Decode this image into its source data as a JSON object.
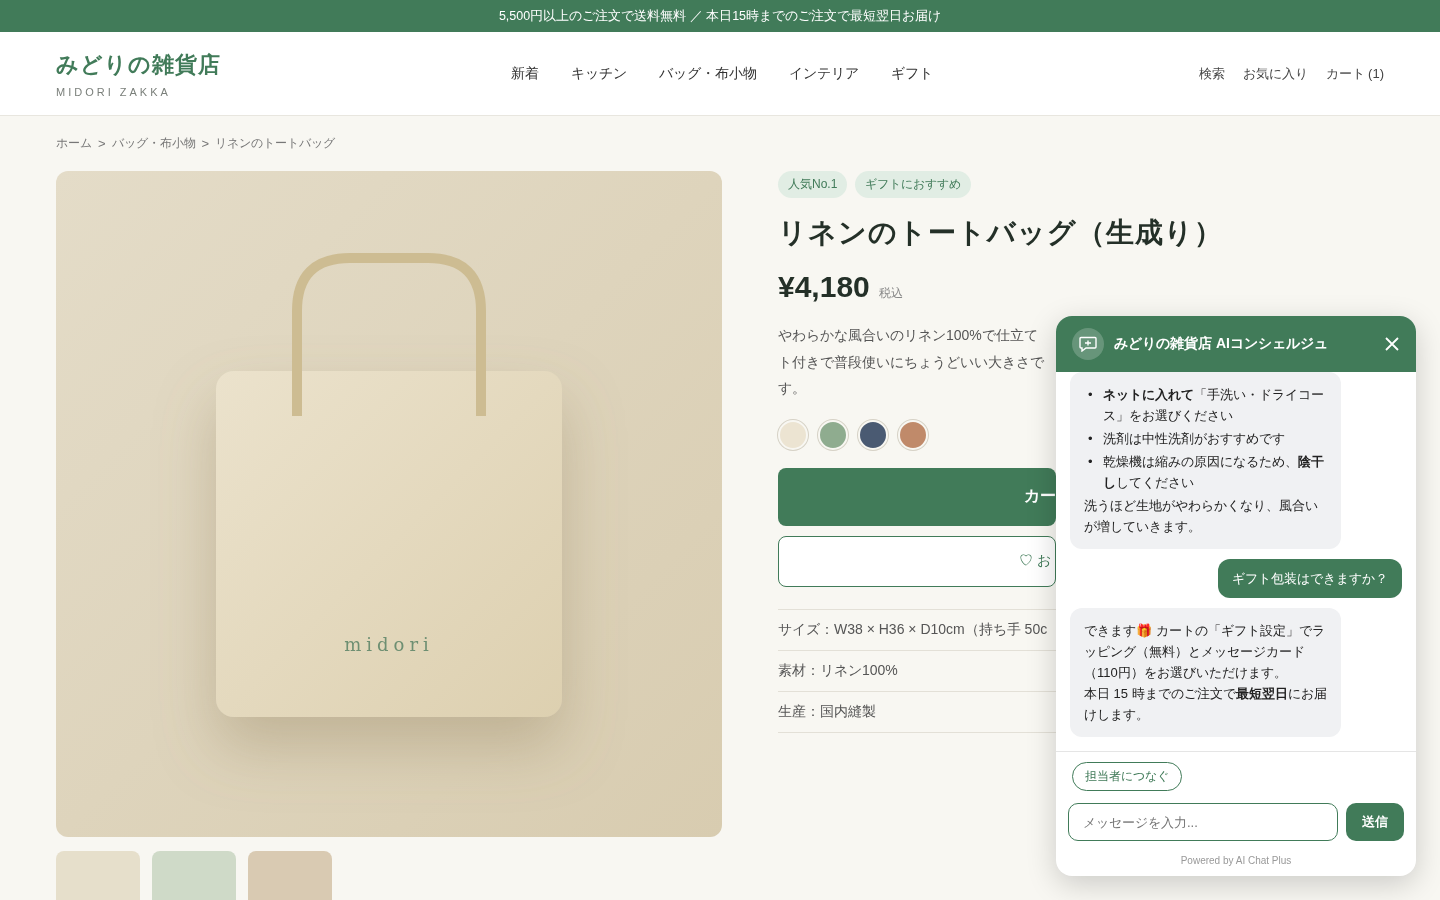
{
  "announcement": "5,500円以上のご注文で送料無料 ／ 本日15時までのご注文で最短翌日お届け",
  "logo": {
    "name": "みどりの雑貨店",
    "subtitle": "MIDORI ZAKKA"
  },
  "nav": [
    "新着",
    "キッチン",
    "バッグ・布小物",
    "インテリア",
    "ギフト"
  ],
  "header_links": [
    "検索",
    "お気に入り",
    "カート (1)"
  ],
  "breadcrumb": [
    "ホーム",
    "バッグ・布小物",
    "リネンのトートバッグ"
  ],
  "breadcrumb_separator": ">",
  "product_image": {
    "bag_label": "midori"
  },
  "thumbnails": [
    {
      "color": "#e6dfcb"
    },
    {
      "color": "#cfdac8"
    },
    {
      "color": "#d9cab2"
    }
  ],
  "tags": [
    "人気No.1",
    "ギフトにおすすめ"
  ],
  "title": "リネンのトートバッグ（生成り）",
  "price": "¥4,180",
  "tax_note": "税込",
  "description_lines": [
    "やわらかな風合いのリネン100%で仕立て",
    "ト付きで普段使いにちょうどいい大きさで",
    "す。"
  ],
  "swatches": [
    {
      "color": "#ece4d2"
    },
    {
      "color": "#8fac8f"
    },
    {
      "color": "#4a5a72"
    },
    {
      "color": "#c08a6a"
    }
  ],
  "cart_button": "カー",
  "favorite_button": {
    "icon": "♡",
    "label": "お"
  },
  "specs": [
    "サイズ：W38 × H36 × D10cm（持ち手 50c",
    "素材：リネン100%",
    "生産：国内縫製"
  ],
  "chat": {
    "title": "みどりの雑貨店 AIコンシェルジュ",
    "messages": [
      {
        "kind": "bot",
        "bullet": "•",
        "bullets": [
          "**ネットに入れて**「手洗い・ドライコース」をお選びください",
          "洗剤は中性洗剤がおすすめです",
          "乾燥機は縮みの原因になるため、**陰干し**してください"
        ],
        "paragraphs": [
          "洗うほど生地がやわらかくなり、風合いが増していきます。"
        ]
      },
      {
        "kind": "user",
        "paragraphs": [
          "ギフト包装はできますか？"
        ]
      },
      {
        "kind": "bot",
        "paragraphs": [
          "できます🎁 カートの「ギフト設定」でラッピング（無料）とメッセージカード（110円）をお選びいただけます。",
          "本日 15 時までのご注文で**最短翌日**にお届けします。"
        ]
      }
    ],
    "quick_reply": "担当者につなぐ",
    "input_placeholder": "メッセージを入力...",
    "send_button": "送信",
    "powered_by": "Powered by AI Chat Plus"
  }
}
